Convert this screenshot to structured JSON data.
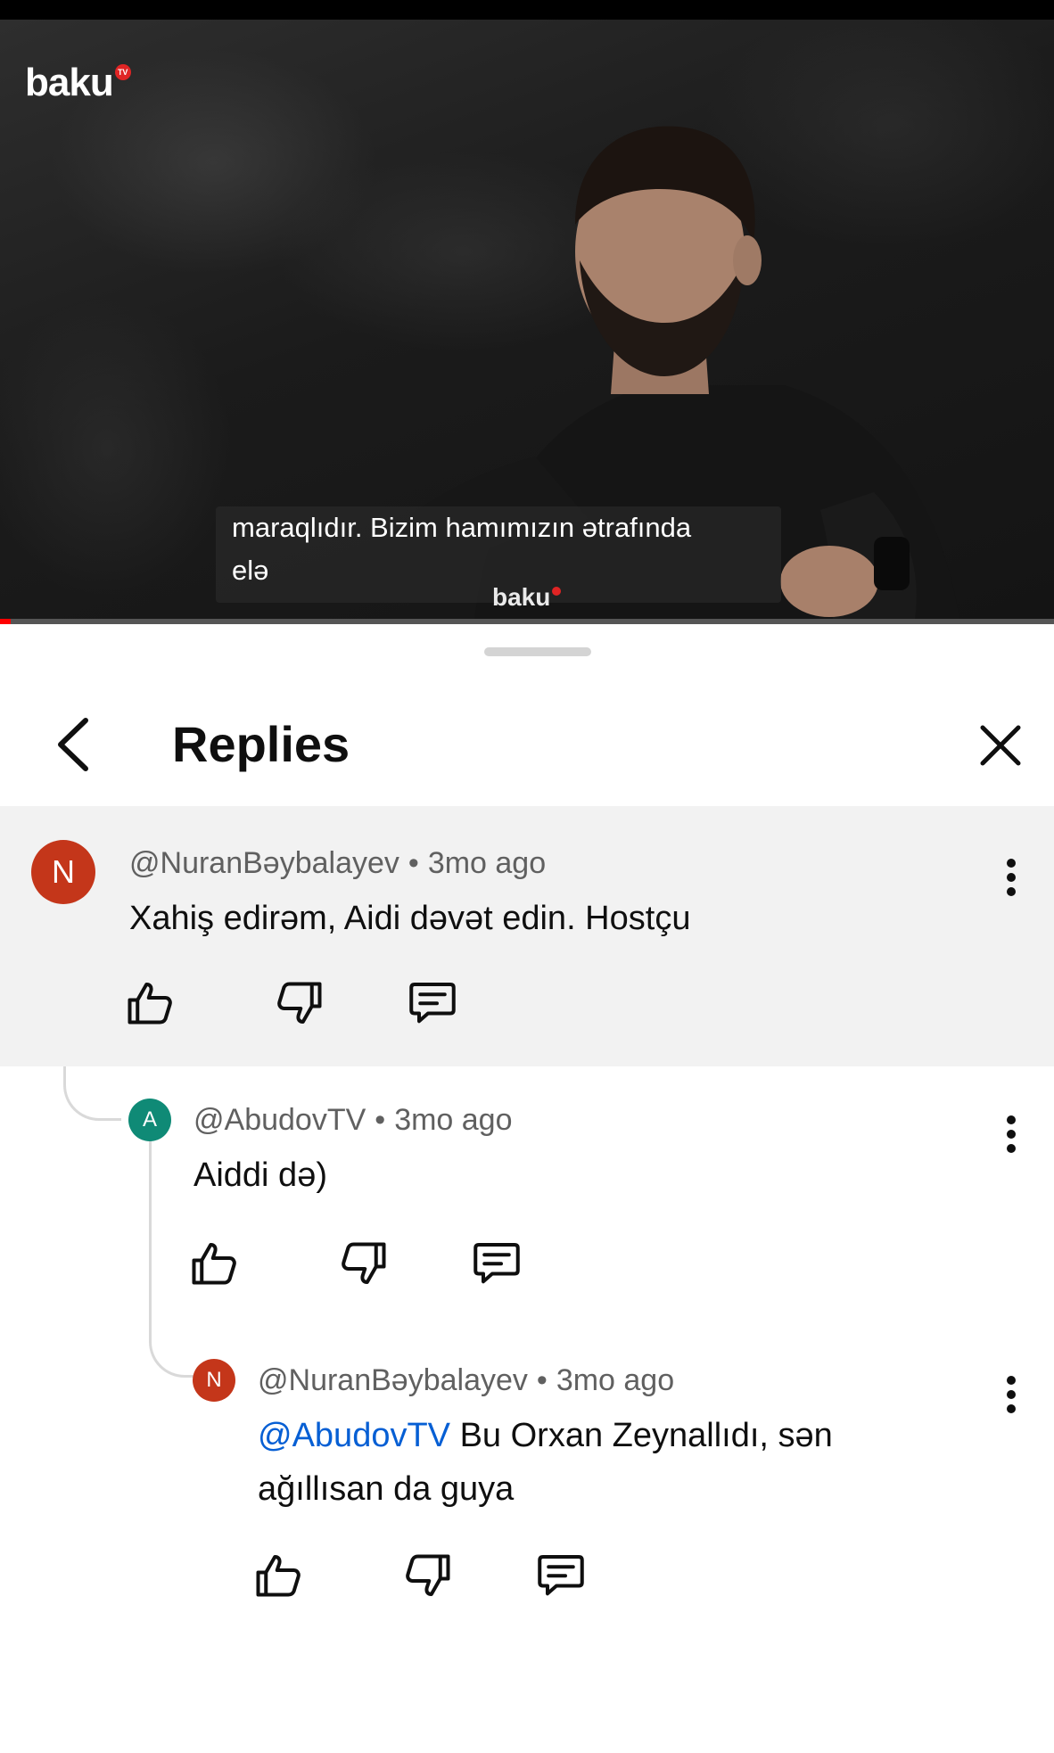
{
  "video": {
    "logo": "baku",
    "logo_badge": "TV",
    "subtitle_line1": "maraqlıdır. Bizim hamımızın ətrafında",
    "subtitle_line2": "elə",
    "watermark": "baku",
    "progress_fraction": 0.01
  },
  "sheet": {
    "title": "Replies"
  },
  "comments": [
    {
      "avatar_letter": "N",
      "avatar_color": "#c4361a",
      "author": "@NuranBəybalayev",
      "separator": "•",
      "age": "3mo ago",
      "text": "Xahiş edirəm, Aidi dəvət edin. Hostçu"
    },
    {
      "avatar_letter": "A",
      "avatar_color": "#0f8a76",
      "author": "@AbudovTV",
      "separator": "•",
      "age": "3mo ago",
      "text": "Aiddi də)"
    },
    {
      "avatar_letter": "N",
      "avatar_color": "#c4361a",
      "author": "@NuranBəybalayev",
      "separator": "•",
      "age": "3mo ago",
      "mention": "@AbudovTV",
      "text_line1": " Bu Orxan Zeynallıdı, sən",
      "text_line2": "ağıllısan da guya"
    }
  ],
  "icons": {
    "back": "chevron-left-icon",
    "close": "close-icon",
    "more": "more-vert-icon",
    "like": "thumb-up-icon",
    "dislike": "thumb-down-icon",
    "reply": "reply-comment-icon"
  }
}
